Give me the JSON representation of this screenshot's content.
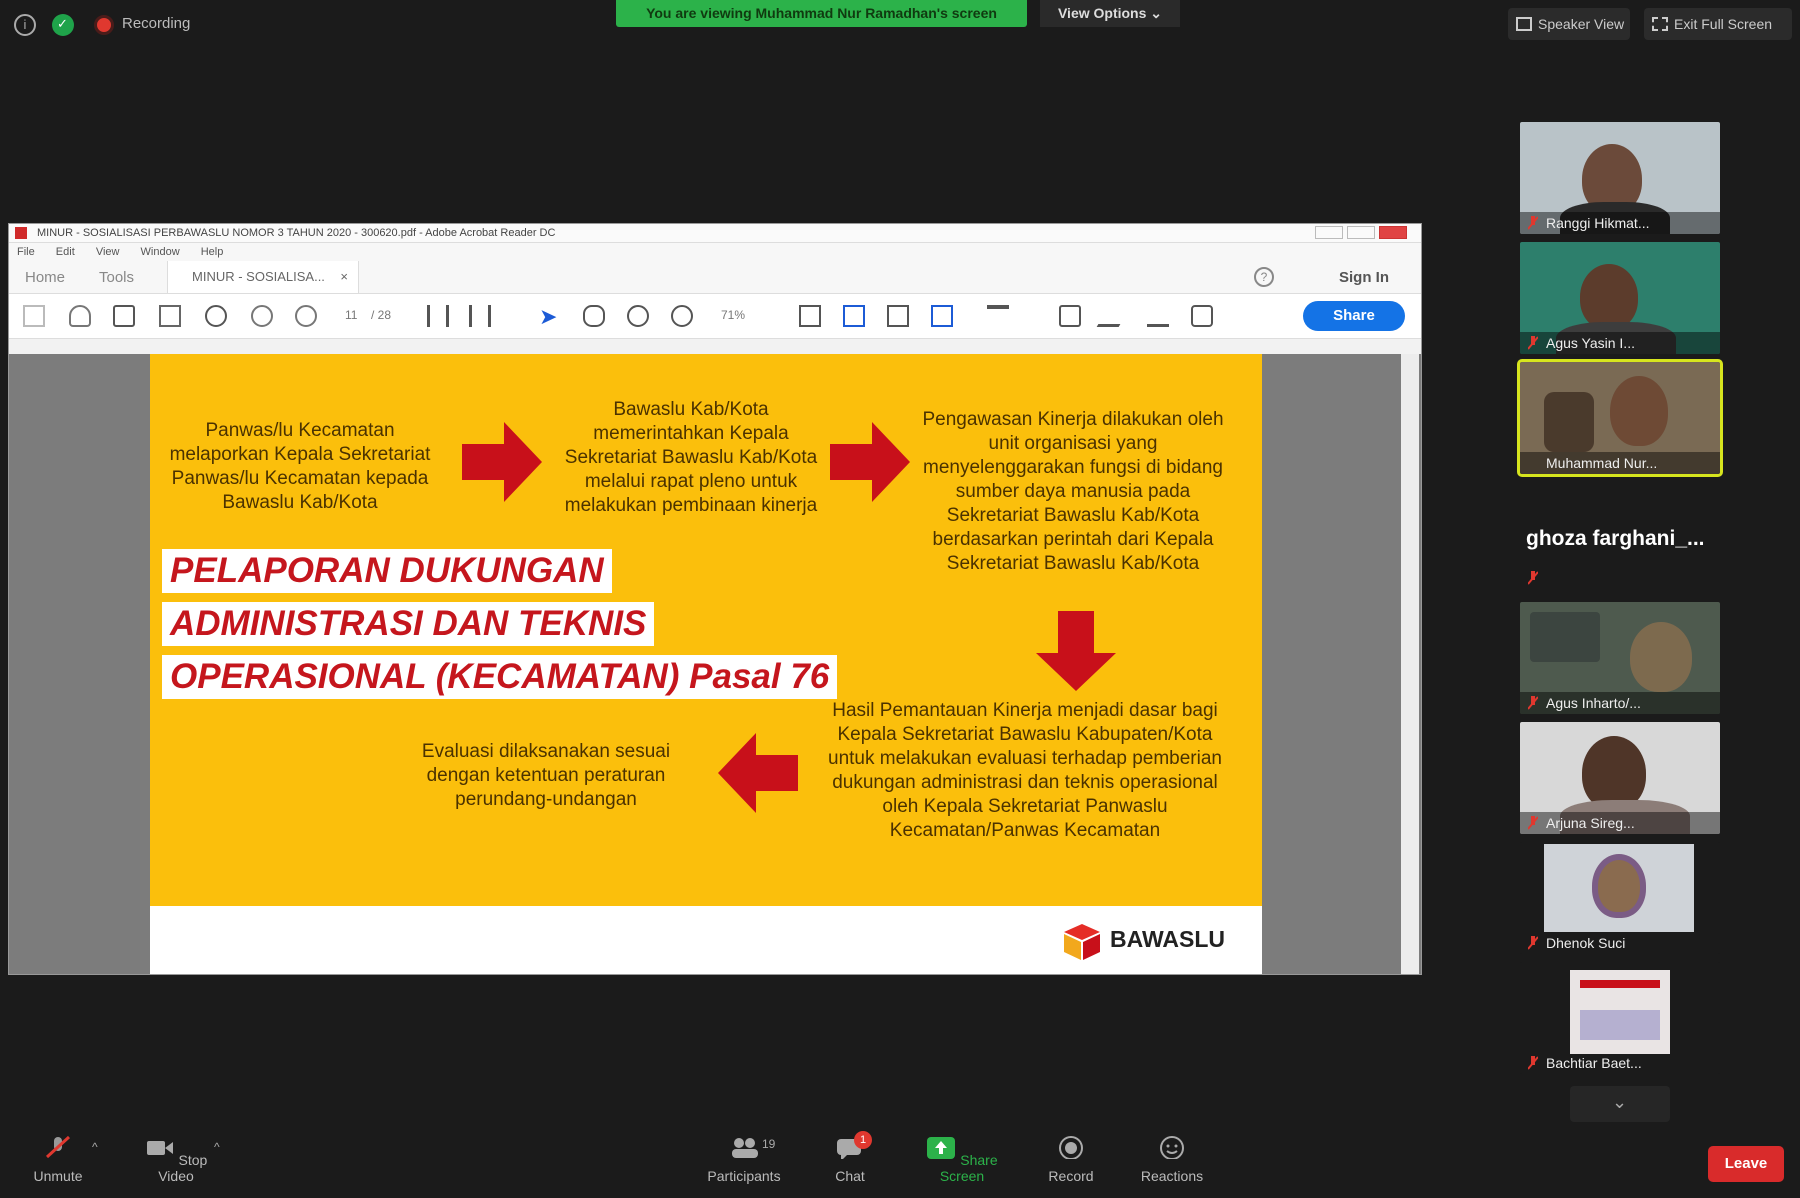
{
  "topbar": {
    "recording_label": "Recording",
    "screen_banner": "You are viewing Muhammad Nur Ramadhan's screen",
    "view_options": "View Options ⌄",
    "speaker_view": "Speaker View",
    "exit_full_screen": "Exit Full Screen"
  },
  "acrobat": {
    "window_title": "MINUR - SOSIALISASI PERBAWASLU NOMOR 3 TAHUN 2020 - 300620.pdf - Adobe Acrobat Reader DC",
    "menu": [
      "File",
      "Edit",
      "View",
      "Window",
      "Help"
    ],
    "tabs": {
      "home": "Home",
      "tools": "Tools",
      "doc": "MINUR - SOSIALISA...",
      "close": "×"
    },
    "help": "?",
    "sign_in": "Sign In",
    "page_num": "11",
    "page_total": "/ 28",
    "zoom": "71%",
    "share": "Share"
  },
  "slide": {
    "box1": "Panwas/lu Kecamatan melaporkan Kepala Sekretariat Panwas/lu Kecamatan kepada Bawaslu Kab/Kota",
    "box2": "Bawaslu Kab/Kota memerintahkan Kepala Sekretariat Bawaslu Kab/Kota melalui rapat pleno untuk melakukan pembinaan kinerja",
    "box3": "Pengawasan Kinerja dilakukan oleh unit organisasi yang menyelenggarakan fungsi di bidang sumber daya manusia pada Sekretariat Bawaslu Kab/Kota berdasarkan perintah dari Kepala Sekretariat Bawaslu Kab/Kota",
    "box4": "Hasil Pemantauan Kinerja menjadi dasar bagi Kepala Sekretariat Bawaslu Kabupaten/Kota untuk melakukan evaluasi terhadap pemberian dukungan administrasi dan teknis operasional oleh Kepala Sekretariat Panwaslu Kecamatan/Panwas Kecamatan",
    "box5": "Evaluasi dilaksanakan sesuai dengan ketentuan peraturan perundang-undangan",
    "headline_1": "PELAPORAN DUKUNGAN",
    "headline_2": "ADMINISTRASI DAN TEKNIS",
    "headline_3": "OPERASIONAL (KECAMATAN) Pasal 76",
    "logo_text": "BAWASLU"
  },
  "participants": [
    {
      "name": "Ranggi Hikmat..."
    },
    {
      "name": "Agus Yasin I..."
    },
    {
      "name": "Muhammad Nur..."
    },
    {
      "name": "ghoza farghani_..."
    },
    {
      "name": "Agus Inharto/..."
    },
    {
      "name": "Arjuna Sireg..."
    },
    {
      "name": "Dhenok Suci"
    },
    {
      "name": "Bachtiar Baet..."
    }
  ],
  "bottombar": {
    "unmute": "Unmute",
    "stop_video": "Stop Video",
    "participants": "Participants",
    "participants_count": "19",
    "chat": "Chat",
    "chat_badge": "1",
    "share_screen": "Share Screen",
    "record": "Record",
    "reactions": "Reactions",
    "leave": "Leave"
  },
  "colors": {
    "slide_bg": "#fbbf0c",
    "arrow_red": "#c8101a",
    "share_green": "#2cb24a",
    "leave_red": "#d92b2b",
    "active_speaker": "#d7e51e",
    "acrobat_blue": "#1473e6"
  }
}
